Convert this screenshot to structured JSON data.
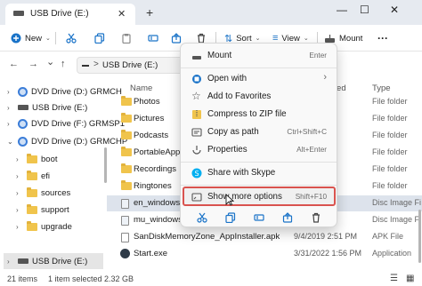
{
  "window": {
    "tab_title": "USB Drive (E:)",
    "tab_close": "✕",
    "new_tab": "+",
    "minimize": "—",
    "maximize": "☐",
    "close": "✕"
  },
  "toolbar": {
    "new_label": "New",
    "sort_label": "Sort",
    "view_label": "View",
    "mount_label": "Mount",
    "more_label": "···"
  },
  "address": {
    "back": "←",
    "forward": "→",
    "up_chevron": "⌄",
    "up": "↑",
    "path": "USB Drive (E:)",
    "sep": ">"
  },
  "sidebar": {
    "items": [
      {
        "label": "DVD Drive (D:) GRMCH"
      },
      {
        "label": "USB Drive (E:)"
      },
      {
        "label": "DVD Drive (F:) GRMSP1"
      },
      {
        "label": "DVD Drive (D:) GRMCHP"
      },
      {
        "label": "boot"
      },
      {
        "label": "efi"
      },
      {
        "label": "sources"
      },
      {
        "label": "support"
      },
      {
        "label": "upgrade"
      },
      {
        "label": "USB Drive (E:)"
      }
    ]
  },
  "filelist": {
    "headers": {
      "name": "Name",
      "date": "Date modified",
      "type": "Type"
    },
    "rows": [
      {
        "name": "Photos",
        "date": "",
        "type": "File folder"
      },
      {
        "name": "Pictures",
        "date": "",
        "type": "File folder"
      },
      {
        "name": "Podcasts",
        "date": "",
        "type": "File folder"
      },
      {
        "name": "PortableApps",
        "date": "",
        "type": "File folder"
      },
      {
        "name": "Recordings",
        "date": "",
        "type": "File folder"
      },
      {
        "name": "Ringtones",
        "date": "",
        "type": "File folder"
      },
      {
        "name": "en_windows_7_h",
        "date": "",
        "type": "Disc Image Fi"
      },
      {
        "name": "mu_windows_7_",
        "date": "",
        "type": "Disc Image Fi"
      },
      {
        "name": "SanDiskMemoryZone_AppInstaller.apk",
        "date": "9/4/2019 2:51 PM",
        "type": "APK File"
      },
      {
        "name": "Start.exe",
        "date": "3/31/2022 1:56 PM",
        "type": "Application"
      }
    ]
  },
  "status": {
    "item_count": "21 items",
    "selected": "1 item selected  2.32 GB"
  },
  "context_menu": {
    "items": [
      {
        "label": "Mount",
        "shortcut": "Enter"
      },
      {
        "label": "Open with",
        "shortcut": "›"
      },
      {
        "label": "Add to Favorites",
        "shortcut": ""
      },
      {
        "label": "Compress to ZIP file",
        "shortcut": ""
      },
      {
        "label": "Copy as path",
        "shortcut": "Ctrl+Shift+C"
      },
      {
        "label": "Properties",
        "shortcut": "Alt+Enter"
      },
      {
        "label": "Share with Skype",
        "shortcut": ""
      },
      {
        "label": "Show more options",
        "shortcut": "Shift+F10"
      }
    ]
  },
  "colors": {
    "accent": "#1a73c8",
    "highlight_border": "#d9534f",
    "folder": "#f0c44c"
  }
}
